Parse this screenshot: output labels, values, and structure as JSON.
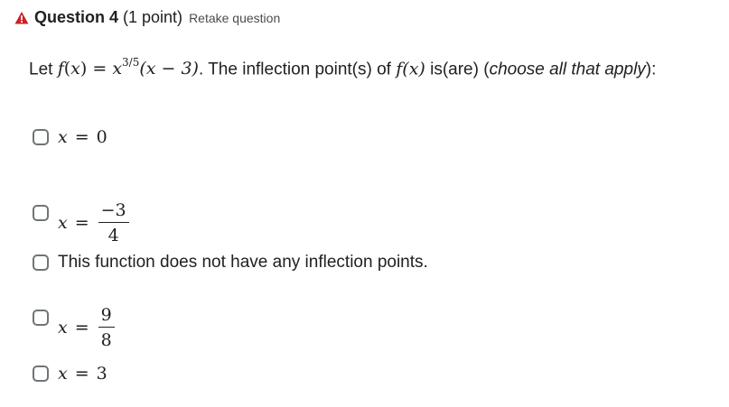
{
  "header": {
    "title": "Question 4",
    "points": "(1 point)",
    "retake_label": "Retake question",
    "warning_icon": "warning-triangle-icon",
    "warning_color": "#cd2026"
  },
  "prompt": {
    "lead": "Let ",
    "f": "f",
    "x": "x",
    "equals": " = ",
    "exponent": "3/5",
    "factor": "(x − 3)",
    "mid": ". The inflection point(s) of ",
    "fx": "f(x)",
    "tail": " is(are) (",
    "emphasis": "choose all that apply",
    "close": "):"
  },
  "options": [
    {
      "type": "math",
      "var": "x",
      "eq": "=",
      "value": "0"
    },
    {
      "type": "fraction",
      "var": "x",
      "eq": "=",
      "numerator": "−3",
      "denominator": "4"
    },
    {
      "type": "text",
      "label": "This function does not have any inflection points."
    },
    {
      "type": "fraction",
      "var": "x",
      "eq": "=",
      "numerator": "9",
      "denominator": "8"
    },
    {
      "type": "math",
      "var": "x",
      "eq": "=",
      "value": "3"
    }
  ],
  "colors": {
    "checkbox_border": "#6e7477",
    "text": "#202122"
  }
}
